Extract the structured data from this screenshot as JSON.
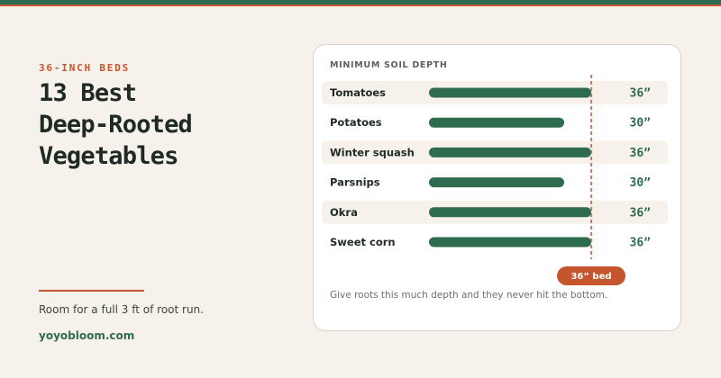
{
  "brand": {
    "top_band_color": "#2e6b4f",
    "accent_color": "#c4552d"
  },
  "hero": {
    "eyebrow": "36-INCH BEDS",
    "title_lines": [
      "13 Best",
      "Deep-Rooted",
      "Vegetables"
    ],
    "note": "Room for a full 3 ft of root run.",
    "site": "yoyobloom.com"
  },
  "card": {
    "caption": "Give roots this much depth and they never hit the bottom."
  },
  "chart_data": {
    "type": "bar",
    "orientation": "horizontal",
    "title": "MINIMUM SOIL DEPTH",
    "categories": [
      "Tomatoes",
      "Potatoes",
      "Winter squash",
      "Parsnips",
      "Okra",
      "Sweet corn"
    ],
    "values": [
      36,
      30,
      36,
      30,
      36,
      36
    ],
    "value_labels": [
      "36”",
      "30”",
      "36”",
      "30”",
      "36”",
      "36”"
    ],
    "unit": "inches",
    "xlim": [
      0,
      36
    ],
    "reference_line": {
      "value": 36,
      "label": "36” bed"
    },
    "bar_color": "#2e6b4f",
    "reference_color": "#c4552d",
    "alternate_row_color": "#f6f1ea",
    "grid": false,
    "legend": "none"
  }
}
